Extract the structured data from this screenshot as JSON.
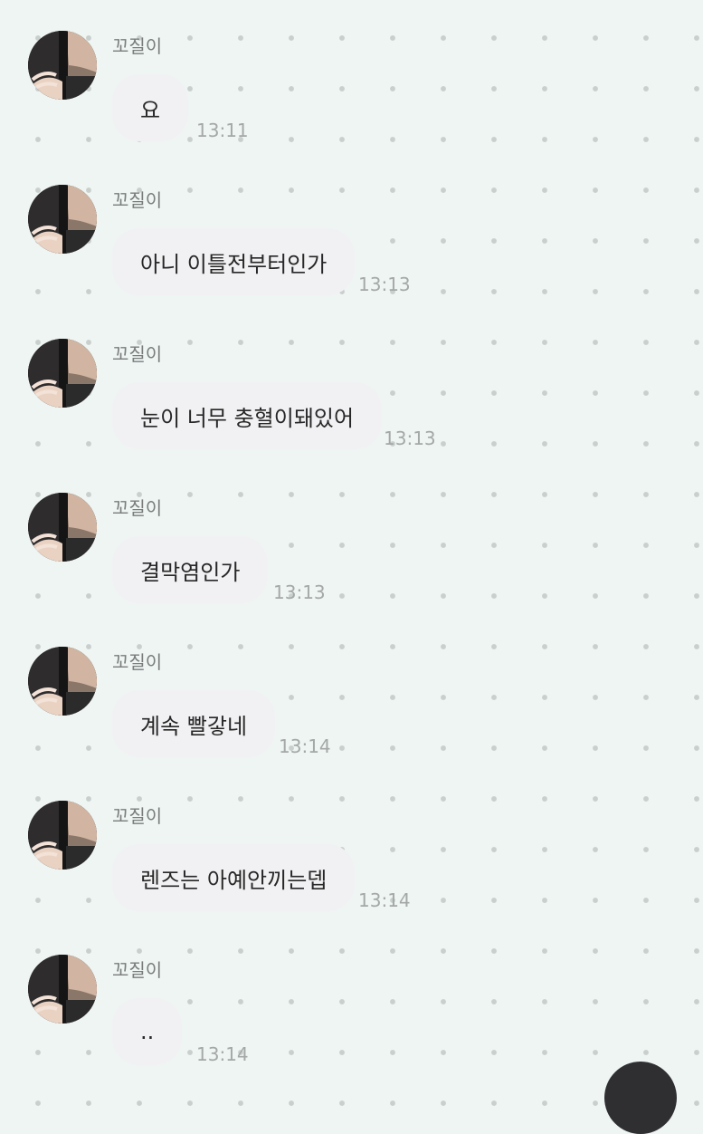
{
  "chat": {
    "messages": [
      {
        "sender": "꼬질이",
        "text": "요",
        "time": "13:11",
        "avatar_icon": "profile-photo"
      },
      {
        "sender": "꼬질이",
        "text": "아니 이틀전부터인가",
        "time": "13:13",
        "avatar_icon": "profile-photo"
      },
      {
        "sender": "꼬질이",
        "text": "눈이 너무 충혈이돼있어",
        "time": "13:13",
        "avatar_icon": "profile-photo"
      },
      {
        "sender": "꼬질이",
        "text": "결막염인가",
        "time": "13:13",
        "avatar_icon": "profile-photo"
      },
      {
        "sender": "꼬질이",
        "text": "계속 빨갛네",
        "time": "13:14",
        "avatar_icon": "profile-photo"
      },
      {
        "sender": "꼬질이",
        "text": "렌즈는 아예안끼는뎁",
        "time": "13:14",
        "avatar_icon": "profile-photo"
      },
      {
        "sender": "꼬질이",
        "text": "..",
        "time": "13:14",
        "avatar_icon": "profile-photo"
      }
    ]
  },
  "colors": {
    "background": "#eef5f3",
    "dot_pattern": "#c9cfcd",
    "bubble": "#f1f1f3",
    "sender_name": "#7a7d7c",
    "timestamp": "#a4a8a7",
    "message_text": "#272727"
  },
  "floating_button": {
    "icon": "scroll-down-button"
  }
}
